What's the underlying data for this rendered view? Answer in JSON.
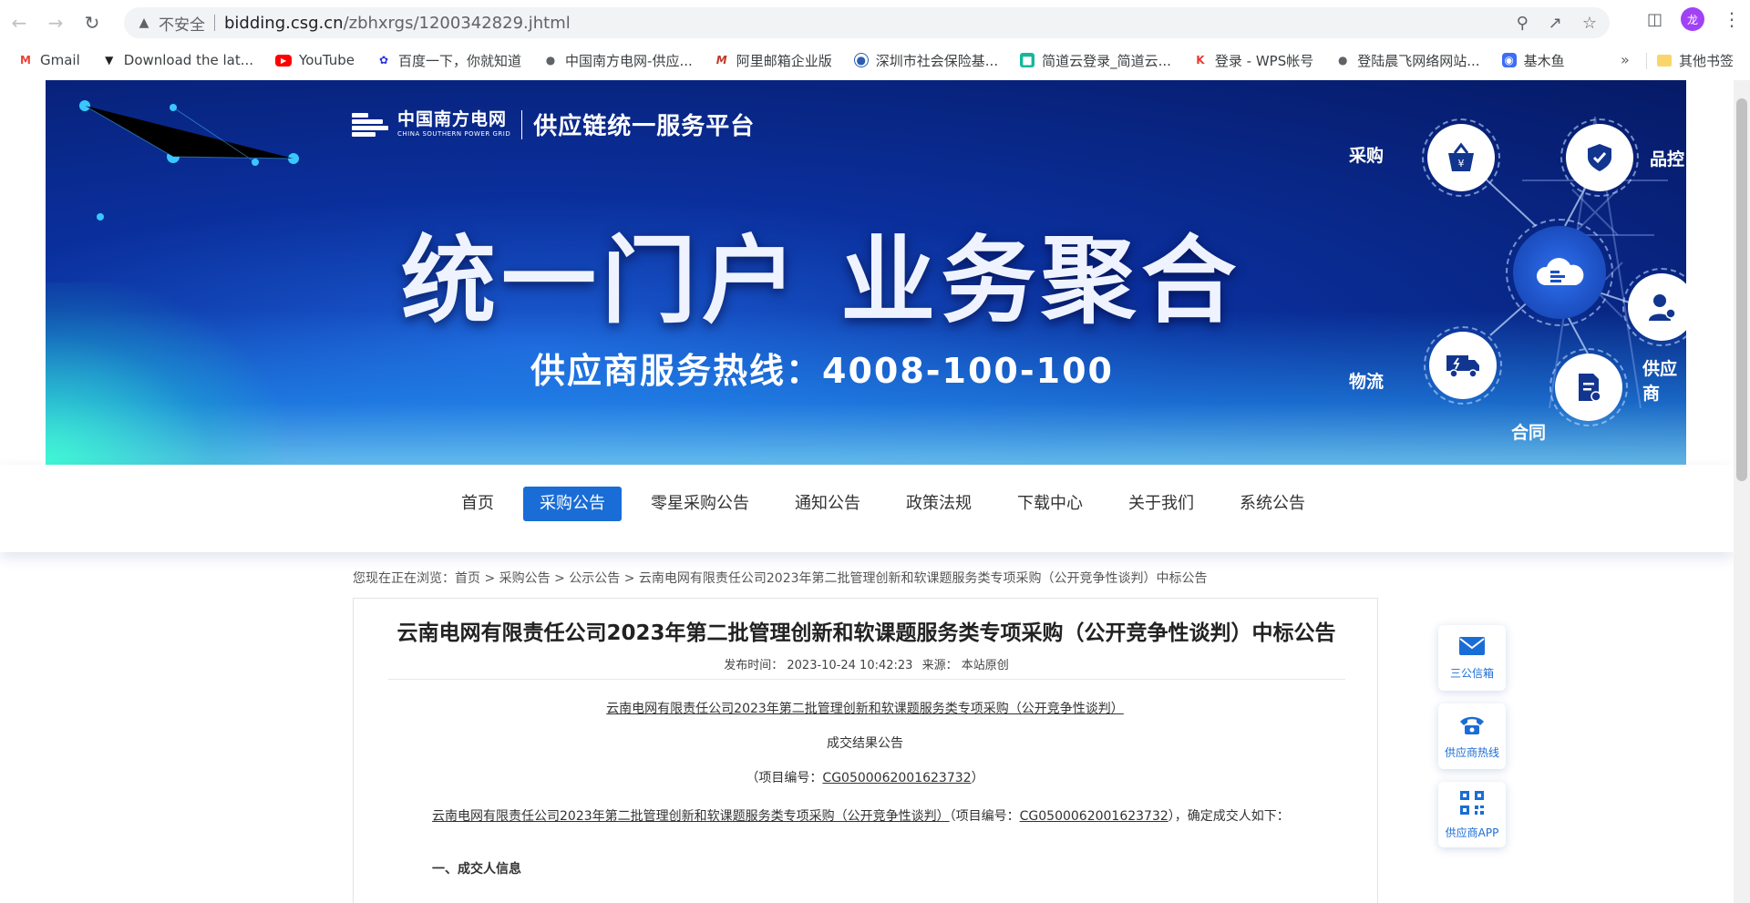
{
  "browser": {
    "insecure_label": "不安全",
    "url_host": "bidding.csg.cn",
    "url_path": "/zbhxrgs/1200342829.jhtml",
    "avatar_letter": "龙",
    "bookmarks_more": "»",
    "bookmarks": [
      {
        "label": "Gmail",
        "icon": "gmail-icon",
        "color": "#ea4335"
      },
      {
        "label": "Download the lat...",
        "icon": "download-site-icon",
        "color": "#202124"
      },
      {
        "label": "YouTube",
        "icon": "youtube-icon",
        "color": "#ff0000"
      },
      {
        "label": "百度一下，你就知道",
        "icon": "baidu-icon",
        "color": "#2932e1"
      },
      {
        "label": "中国南方电网-供应...",
        "icon": "globe-icon",
        "color": "#5f6368"
      },
      {
        "label": "阿里邮箱企业版",
        "icon": "ali-mail-icon",
        "color": "#c0392b"
      },
      {
        "label": "深圳市社会保险基...",
        "icon": "shebao-icon",
        "color": "#2a5db0"
      },
      {
        "label": "简道云登录_简道云...",
        "icon": "jiandaoyun-icon",
        "color": "#14b89a"
      },
      {
        "label": "登录 - WPS帐号",
        "icon": "wps-icon",
        "color": "#e63b2e"
      },
      {
        "label": "登陆晨飞网络网站...",
        "icon": "globe-icon",
        "color": "#5f6368"
      },
      {
        "label": "基木鱼",
        "icon": "jimuyu-icon",
        "color": "#3d6cf6"
      }
    ],
    "other_bookmarks": "其他书签"
  },
  "banner": {
    "logo_cn": "中国南方电网",
    "logo_en": "CHINA SOUTHERN POWER GRID",
    "platform": "供应链统一服务平台",
    "headline": "统一门户 业务聚合",
    "hotline": "供应商服务热线：4008-100-100",
    "nodes": {
      "purchase": "采购",
      "quality": "品控",
      "supplier": "供应商",
      "contract": "合同",
      "logistics": "物流"
    }
  },
  "nav": {
    "items": [
      "首页",
      "采购公告",
      "零星采购公告",
      "通知公告",
      "政策法规",
      "下载中心",
      "关于我们",
      "系统公告"
    ],
    "active": "采购公告"
  },
  "breadcrumb": {
    "prefix": "您现在正在浏览：",
    "trail": "首页 > 采购公告 > 公示公告 > 云南电网有限责任公司2023年第二批管理创新和软课题服务类专项采购（公开竞争性谈判）中标公告"
  },
  "article": {
    "title": "云南电网有限责任公司2023年第二批管理创新和软课题服务类专项采购（公开竞争性谈判）中标公告",
    "publish_label": "发布时间：",
    "publish_time": "2023-10-24 10:42:23",
    "source_label": "来源：",
    "source": "本站原创",
    "project_name": "云南电网有限责任公司2023年第二批管理创新和软课题服务类专项采购（公开竞争性谈判）",
    "notice_type": "成交结果公告",
    "project_no_prefix": "（项目编号：",
    "project_no": "CG0500062001623732",
    "project_no_suffix": "）",
    "para_mid": "（项目编号：",
    "para_tail": "），确定成交人如下：",
    "section1": "一、成交人信息"
  },
  "side": {
    "mailbox": "三公信箱",
    "hotline": "供应商热线",
    "app": "供应商APP"
  },
  "colors": {
    "brand_blue": "#1a6dd6",
    "banner_dark": "#061a66"
  }
}
